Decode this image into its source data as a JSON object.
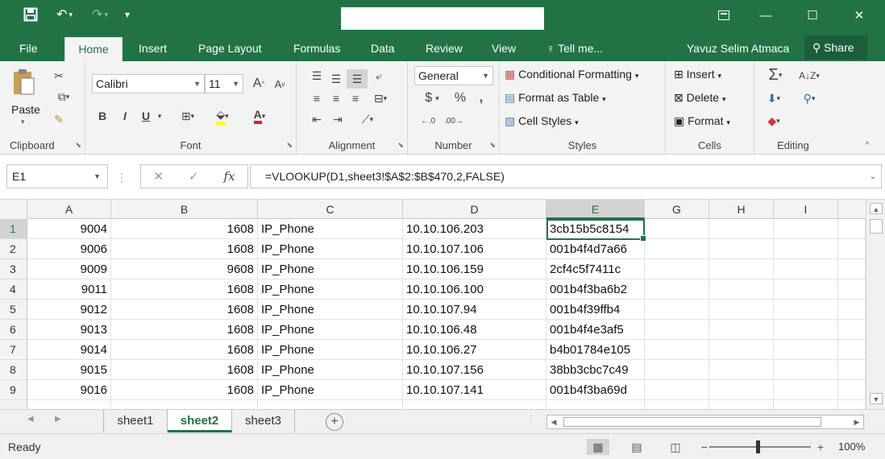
{
  "titlebar": {
    "save_icon": "save-icon",
    "undo_icon": "undo-icon",
    "redo_icon": "redo-icon"
  },
  "ribbon_tabs": [
    "File",
    "Home",
    "Insert",
    "Page Layout",
    "Formulas",
    "Data",
    "Review",
    "View"
  ],
  "tell_me": "Tell me...",
  "user_name": "Yavuz Selim Atmaca",
  "share_label": "Share",
  "clipboard": {
    "paste_label": "Paste",
    "group_label": "Clipboard"
  },
  "font": {
    "name": "Calibri",
    "size": "11",
    "bold": "B",
    "italic": "I",
    "underline": "U",
    "group_label": "Font"
  },
  "alignment": {
    "group_label": "Alignment"
  },
  "number": {
    "format": "General",
    "currency": "$",
    "percent": "%",
    "comma": ",",
    "group_label": "Number"
  },
  "styles": {
    "conditional_formatting": "Conditional Formatting",
    "format_as_table": "Format as Table",
    "cell_styles": "Cell Styles",
    "group_label": "Styles"
  },
  "cells": {
    "insert": "Insert",
    "delete": "Delete",
    "format": "Format",
    "group_label": "Cells"
  },
  "editing": {
    "group_label": "Editing"
  },
  "name_box": "E1",
  "formula": "=VLOOKUP(D1,sheet3!$A$2:$B$470,2,FALSE)",
  "columns": [
    "A",
    "B",
    "C",
    "D",
    "E",
    "G",
    "H",
    "I"
  ],
  "rows": [
    {
      "n": "1",
      "a": "9004",
      "b": "1608",
      "c": "IP_Phone",
      "d": "10.10.106.203",
      "e": "3cb15b5c8154"
    },
    {
      "n": "2",
      "a": "9006",
      "b": "1608",
      "c": "IP_Phone",
      "d": "10.10.107.106",
      "e": "001b4f4d7a66"
    },
    {
      "n": "3",
      "a": "9009",
      "b": "9608",
      "c": "IP_Phone",
      "d": "10.10.106.159",
      "e": "2cf4c5f7411c"
    },
    {
      "n": "4",
      "a": "9011",
      "b": "1608",
      "c": "IP_Phone",
      "d": "10.10.106.100",
      "e": "001b4f3ba6b2"
    },
    {
      "n": "5",
      "a": "9012",
      "b": "1608",
      "c": "IP_Phone",
      "d": "10.10.107.94",
      "e": "001b4f39ffb4"
    },
    {
      "n": "6",
      "a": "9013",
      "b": "1608",
      "c": "IP_Phone",
      "d": "10.10.106.48",
      "e": "001b4f4e3af5"
    },
    {
      "n": "7",
      "a": "9014",
      "b": "1608",
      "c": "IP_Phone",
      "d": "10.10.106.27",
      "e": "b4b01784e105"
    },
    {
      "n": "8",
      "a": "9015",
      "b": "1608",
      "c": "IP_Phone",
      "d": "10.10.107.156",
      "e": "38bb3cbc7c49"
    },
    {
      "n": "9",
      "a": "9016",
      "b": "1608",
      "c": "IP_Phone",
      "d": "10.10.107.141",
      "e": "001b4f3ba69d"
    }
  ],
  "sheets": [
    "sheet1",
    "sheet2",
    "sheet3"
  ],
  "status": "Ready",
  "zoom": "100%"
}
